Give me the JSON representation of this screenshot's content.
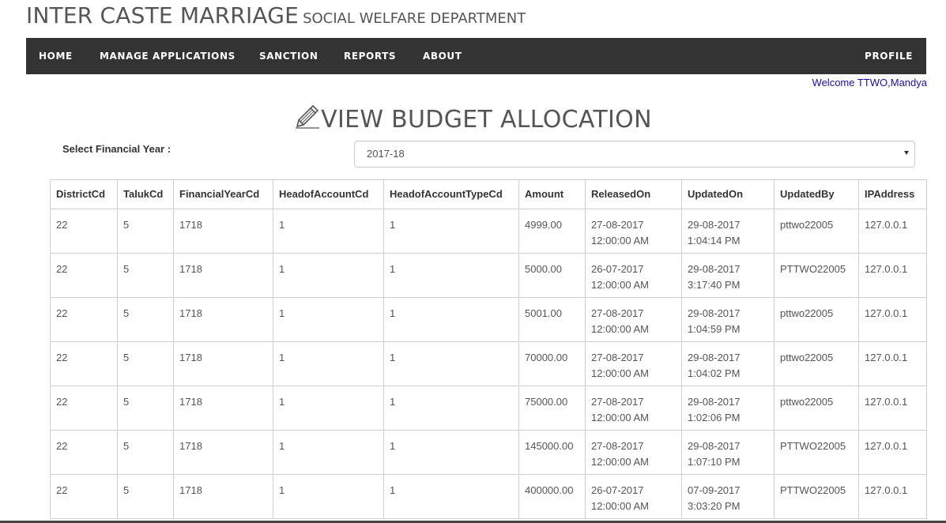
{
  "header": {
    "title": "INTER CASTE MARRIAGE",
    "subtitle": "SOCIAL WELFARE DEPARTMENT"
  },
  "nav": {
    "home": "HOME",
    "manage_applications": "MANAGE APPLICATIONS",
    "sanction": "SANCTION",
    "reports": "REPORTS",
    "about": "ABOUT",
    "profile": "PROFILE"
  },
  "welcome": "Welcome TTWO,Mandya",
  "page_title": "VIEW BUDGET ALLOCATION",
  "page_icon": "pencil-icon",
  "filter": {
    "label": "Select Financial Year :",
    "selected": "2017-18"
  },
  "table": {
    "columns": [
      "DistrictCd",
      "TalukCd",
      "FinancialYearCd",
      "HeadofAccountCd",
      "HeadofAccountTypeCd",
      "Amount",
      "ReleasedOn",
      "UpdatedOn",
      "UpdatedBy",
      "IPAddress"
    ],
    "rows": [
      [
        "22",
        "5",
        "1718",
        "1",
        "1",
        "4999.00",
        "27-08-2017 12:00:00 AM",
        "29-08-2017 1:04:14 PM",
        "pttwo22005",
        "127.0.0.1"
      ],
      [
        "22",
        "5",
        "1718",
        "1",
        "1",
        "5000.00",
        "26-07-2017 12:00:00 AM",
        "29-08-2017 3:17:40 PM",
        "PTTWO22005",
        "127.0.0.1"
      ],
      [
        "22",
        "5",
        "1718",
        "1",
        "1",
        "5001.00",
        "27-08-2017 12:00:00 AM",
        "29-08-2017 1:04:59 PM",
        "pttwo22005",
        "127.0.0.1"
      ],
      [
        "22",
        "5",
        "1718",
        "1",
        "1",
        "70000.00",
        "27-08-2017 12:00:00 AM",
        "29-08-2017 1:04:02 PM",
        "pttwo22005",
        "127.0.0.1"
      ],
      [
        "22",
        "5",
        "1718",
        "1",
        "1",
        "75000.00",
        "27-08-2017 12:00:00 AM",
        "29-08-2017 1:02:06 PM",
        "pttwo22005",
        "127.0.0.1"
      ],
      [
        "22",
        "5",
        "1718",
        "1",
        "1",
        "145000.00",
        "27-08-2017 12:00:00 AM",
        "29-08-2017 1:07:10 PM",
        "PTTWO22005",
        "127.0.0.1"
      ],
      [
        "22",
        "5",
        "1718",
        "1",
        "1",
        "400000.00",
        "26-07-2017 12:00:00 AM",
        "07-09-2017 3:03:20 PM",
        "PTTWO22005",
        "127.0.0.1"
      ]
    ]
  },
  "colors": {
    "navbar": "#333333",
    "welcome_link": "#1a0dab",
    "border": "#cfcfcf"
  }
}
